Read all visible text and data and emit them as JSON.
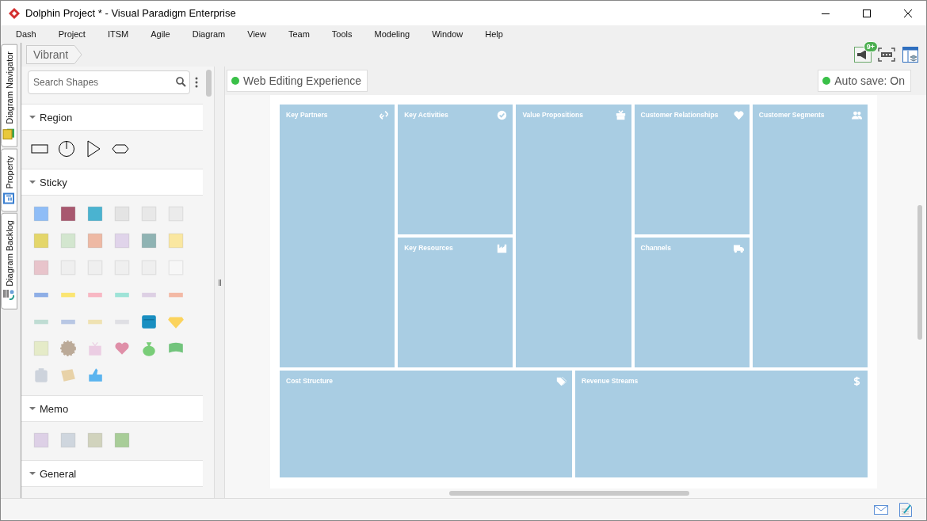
{
  "window": {
    "title": "Dolphin Project * - Visual Paradigm Enterprise"
  },
  "menu": [
    "Dash",
    "Project",
    "ITSM",
    "Agile",
    "Diagram",
    "View",
    "Team",
    "Tools",
    "Modeling",
    "Window",
    "Help"
  ],
  "side_tabs": [
    "Diagram Navigator",
    "Property",
    "Diagram Backlog"
  ],
  "breadcrumb": "Vibrant",
  "notification_badge": "9+",
  "palette": {
    "search": {
      "placeholder": "Search Shapes"
    },
    "sections": [
      {
        "title": "Region",
        "kind": "region",
        "expanded": true
      },
      {
        "title": "Sticky",
        "kind": "sticky",
        "expanded": true
      },
      {
        "title": "Memo",
        "kind": "memo",
        "expanded": true
      },
      {
        "title": "General",
        "kind": "general",
        "expanded": true
      }
    ]
  },
  "editor": {
    "web_editing": "Web Editing Experience",
    "autosave": "Auto save: On"
  },
  "canvas": {
    "columns": [
      {
        "cells": [
          {
            "title": "Key Partners",
            "kind": "link"
          }
        ]
      },
      {
        "cells": [
          {
            "title": "Key Activities",
            "kind": "check"
          },
          {
            "title": "Key Resources",
            "kind": "factory"
          }
        ]
      },
      {
        "cells": [
          {
            "title": "Value Propositions",
            "kind": "gift"
          }
        ]
      },
      {
        "cells": [
          {
            "title": "Customer Relationships",
            "kind": "heart"
          },
          {
            "title": "Channels",
            "kind": "truck"
          }
        ]
      },
      {
        "cells": [
          {
            "title": "Customer Segments",
            "kind": "users"
          }
        ]
      }
    ],
    "bottom": [
      {
        "title": "Cost Structure",
        "kind": "tag"
      },
      {
        "title": "Revenue Streams",
        "kind": "dollar"
      }
    ]
  }
}
